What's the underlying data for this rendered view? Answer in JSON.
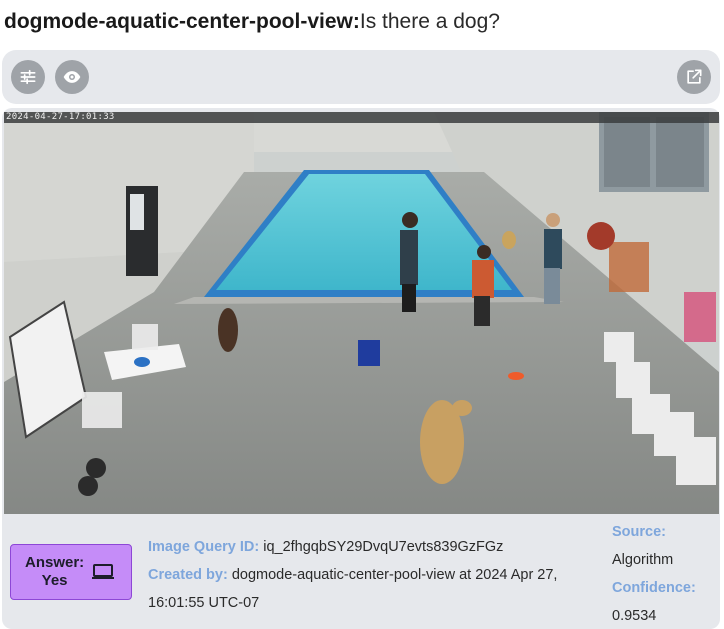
{
  "header": {
    "detector_name": "dogmode-aquatic-center-pool-view:",
    "query": "Is there a dog?"
  },
  "toolbar": {
    "left_icons": [
      "sliders-icon",
      "eye-icon"
    ],
    "right_icons": [
      "open-external-icon"
    ]
  },
  "camera": {
    "timestamp": "2024-04-27-17:01:33"
  },
  "answer": {
    "line1": "Answer:",
    "line2": "Yes",
    "icon": "laptop-icon"
  },
  "meta": {
    "image_query_label": "Image Query ID:",
    "image_query_value": "iq_2fhgqbSY29DvqU7evts839GzFGz",
    "created_label": "Created by:",
    "created_value": "dogmode-aquatic-center-pool-view at 2024 Apr 27, 16:01:55 UTC-07"
  },
  "side": {
    "source_label": "Source:",
    "source_value": "Algorithm",
    "confidence_label": "Confidence:",
    "confidence_value": "0.9534"
  },
  "colors": {
    "accent_label": "#7ea6dc",
    "answer_bg": "#c58cf8",
    "panel_bg": "#e6e8ec",
    "button_bg": "#9fa3a8"
  }
}
